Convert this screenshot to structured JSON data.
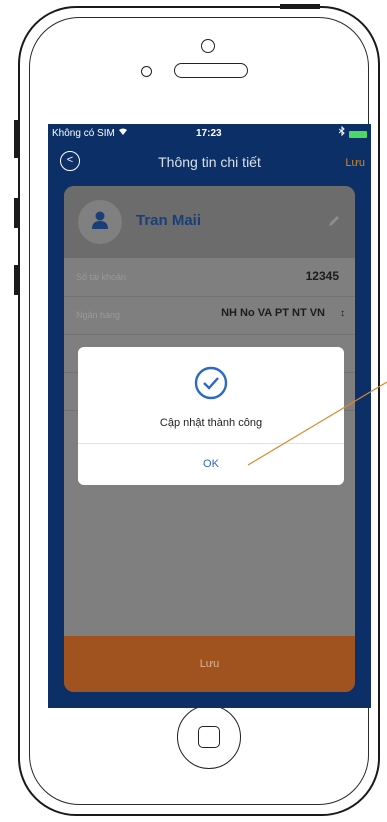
{
  "status_bar": {
    "carrier": "Không có SIM",
    "wifi_icon": "wifi-icon",
    "time": "17:23",
    "bluetooth_icon": "bluetooth-icon",
    "battery_icon": "battery-icon"
  },
  "nav": {
    "back_icon": "back-circle-icon",
    "title": "Thông tin chi tiết",
    "save_label": "Lưu"
  },
  "profile": {
    "avatar_icon": "user-icon",
    "name": "Tran Maii",
    "edit_icon": "pencil-icon"
  },
  "fields": [
    {
      "label": "Số tài khoản",
      "value": "12345"
    },
    {
      "label": "Ngân hàng",
      "value": "NH No VA PT NT VN"
    }
  ],
  "bottom_button": {
    "label": "Lưu"
  },
  "dialog": {
    "icon": "check-circle-icon",
    "message": "Cập nhật thành công",
    "ok_label": "OK"
  },
  "colors": {
    "header_bg": "#0b2f66",
    "accent_orange": "#d08a2e",
    "primary_blue": "#2d68c4",
    "callout_line": "#d9882e"
  }
}
